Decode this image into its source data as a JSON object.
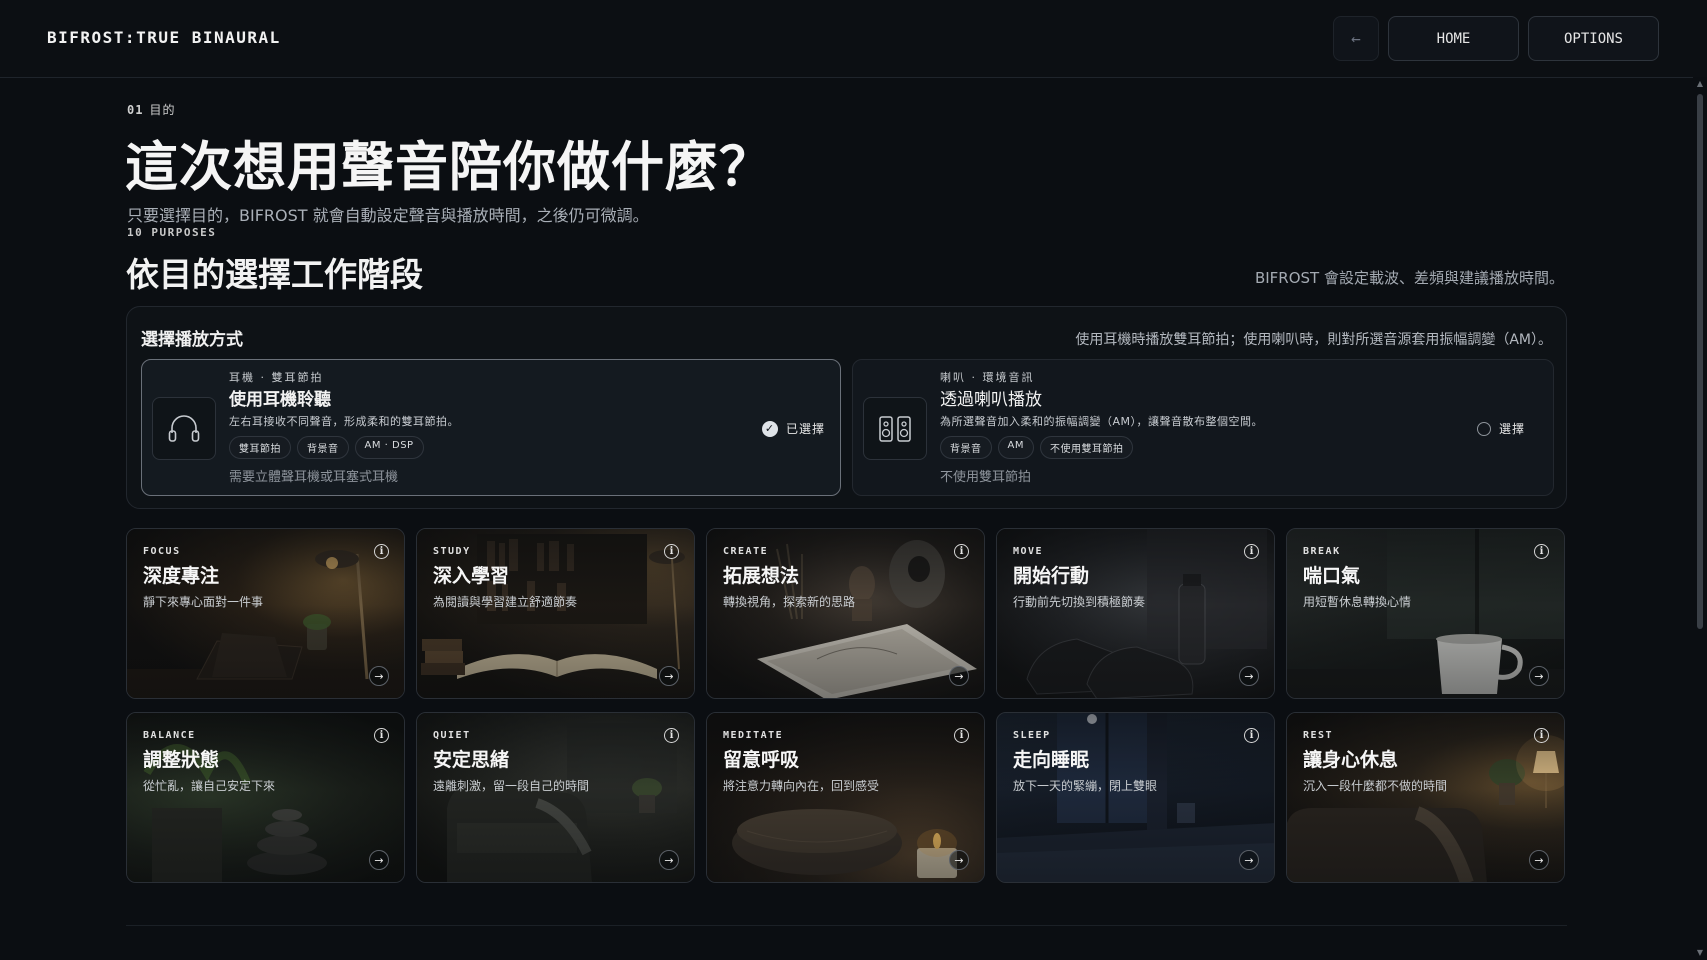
{
  "app": {
    "brand": "BIFROST:TRUE BINAURAL"
  },
  "nav": {
    "back_icon": "←",
    "home": "HOME",
    "options": "OPTIONS"
  },
  "intro": {
    "step_num": "01",
    "step_label": "目的",
    "title": "這次想用聲音陪你做什麼？",
    "subtitle": "只要選擇目的，BIFROST 就會自動設定聲音與播放時間，之後仍可微調。"
  },
  "section": {
    "kicker": "10 PURPOSES",
    "title": "依目的選擇工作階段",
    "note": "BIFROST 會設定載波、差頻與建議播放時間。"
  },
  "playback": {
    "title": "選擇播放方式",
    "note": "使用耳機時播放雙耳節拍；使用喇叭時，則對所選音源套用振幅調變（AM）。",
    "modes": [
      {
        "kicker": "耳機 · 雙耳節拍",
        "name": "使用耳機聆聽",
        "desc": "左右耳接收不同聲音，形成柔和的雙耳節拍。",
        "tags": [
          "雙耳節拍",
          "背景音",
          "AM · DSP"
        ],
        "foot": "需要立體聲耳機或耳塞式耳機",
        "state": "已選擇",
        "icon": "headphones-icon",
        "selected": true
      },
      {
        "kicker": "喇叭 · 環境音訊",
        "name": "透過喇叭播放",
        "desc": "為所選聲音加入柔和的振幅調變（AM），讓聲音散布整個空間。",
        "tags": [
          "背景音",
          "AM",
          "不使用雙耳節拍"
        ],
        "foot": "不使用雙耳節拍",
        "state": "選擇",
        "icon": "speakers-icon",
        "selected": false
      }
    ]
  },
  "purposes": [
    {
      "code": "FOCUS",
      "name": "深度專注",
      "desc": "靜下來專心面對一件事"
    },
    {
      "code": "STUDY",
      "name": "深入學習",
      "desc": "為閱讀與學習建立舒適節奏"
    },
    {
      "code": "CREATE",
      "name": "拓展想法",
      "desc": "轉換視角，探索新的思路"
    },
    {
      "code": "MOVE",
      "name": "開始行動",
      "desc": "行動前先切換到積極節奏"
    },
    {
      "code": "BREAK",
      "name": "喘口氣",
      "desc": "用短暫休息轉換心情"
    },
    {
      "code": "BALANCE",
      "name": "調整狀態",
      "desc": "從忙亂，讓自己安定下來"
    },
    {
      "code": "QUIET",
      "name": "安定思緒",
      "desc": "遠離刺激，留一段自己的時間"
    },
    {
      "code": "MEDITATE",
      "name": "留意呼吸",
      "desc": "將注意力轉向內在，回到感受"
    },
    {
      "code": "SLEEP",
      "name": "走向睡眠",
      "desc": "放下一天的緊繃，閉上雙眼"
    },
    {
      "code": "REST",
      "name": "讓身心休息",
      "desc": "沉入一段什麼都不做的時間"
    }
  ],
  "icons": {
    "info": "i",
    "arrow": "→"
  },
  "colors": {
    "background": "#0b0e12",
    "panel": "#0e1216",
    "selected_border": "#6a7079"
  }
}
